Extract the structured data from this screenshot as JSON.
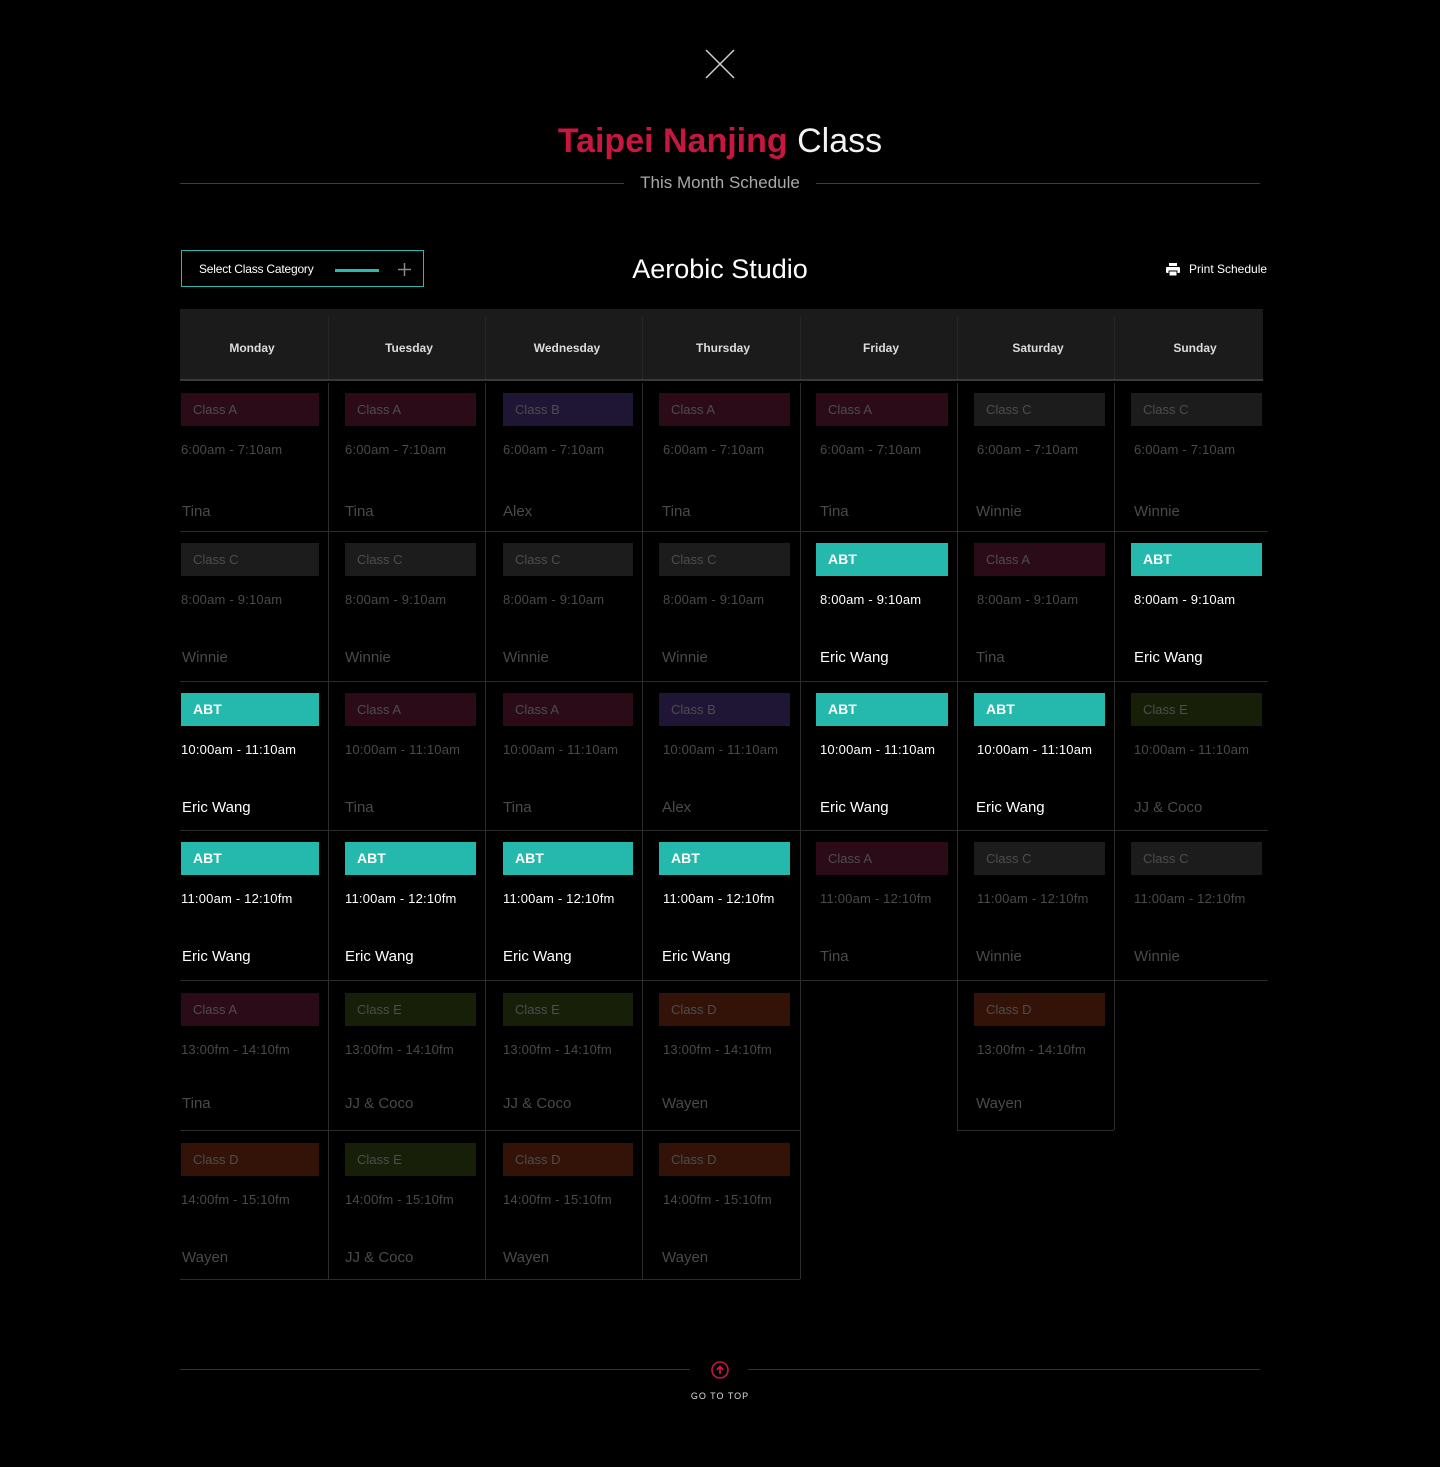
{
  "page": {
    "title_highlight": "Taipei Nanjing",
    "title_rest": "Class",
    "subtitle": "This Month Schedule",
    "studio": "Aerobic Studio",
    "select_label": "Select Class Category",
    "print_label": "Print Schedule",
    "go_to_top": "GO TO TOP"
  },
  "colors": {
    "accent": "#c8173e",
    "teal": "#25b9ad",
    "class_a": "#2b0b17",
    "class_b": "#1f1535",
    "class_c": "#1c1c1c",
    "class_d": "#331307",
    "class_e": "#171f08"
  },
  "days": [
    "Monday",
    "Tuesday",
    "Wednesday",
    "Thursday",
    "Friday",
    "Saturday",
    "Sunday"
  ],
  "schedule": [
    [
      {
        "cls": "Class A",
        "time": "6:00am - 7:10am",
        "teacher": "Tina",
        "type": "A"
      },
      {
        "cls": "Class C",
        "time": "8:00am - 9:10am",
        "teacher": "Winnie",
        "type": "C"
      },
      {
        "cls": "ABT",
        "time": "10:00am - 11:10am",
        "teacher": "Eric Wang",
        "type": "ABT"
      },
      {
        "cls": "ABT",
        "time": "11:00am - 12:10fm",
        "teacher": "Eric Wang",
        "type": "ABT"
      },
      {
        "cls": "Class A",
        "time": "13:00fm - 14:10fm",
        "teacher": "Tina",
        "type": "A"
      },
      {
        "cls": "Class D",
        "time": "14:00fm - 15:10fm",
        "teacher": "Wayen",
        "type": "D"
      }
    ],
    [
      {
        "cls": "Class A",
        "time": "6:00am - 7:10am",
        "teacher": "Tina",
        "type": "A"
      },
      {
        "cls": "Class C",
        "time": "8:00am - 9:10am",
        "teacher": "Winnie",
        "type": "C"
      },
      {
        "cls": "Class A",
        "time": "10:00am - 11:10am",
        "teacher": "Tina",
        "type": "A"
      },
      {
        "cls": "ABT",
        "time": "11:00am - 12:10fm",
        "teacher": "Eric Wang",
        "type": "ABT"
      },
      {
        "cls": "Class E",
        "time": "13:00fm - 14:10fm",
        "teacher": "JJ & Coco",
        "type": "E"
      },
      {
        "cls": "Class E",
        "time": "14:00fm - 15:10fm",
        "teacher": "JJ & Coco",
        "type": "E"
      }
    ],
    [
      {
        "cls": "Class B",
        "time": "6:00am - 7:10am",
        "teacher": "Alex",
        "type": "B"
      },
      {
        "cls": "Class C",
        "time": "8:00am - 9:10am",
        "teacher": "Winnie",
        "type": "C"
      },
      {
        "cls": "Class A",
        "time": "10:00am - 11:10am",
        "teacher": "Tina",
        "type": "A"
      },
      {
        "cls": "ABT",
        "time": "11:00am - 12:10fm",
        "teacher": "Eric Wang",
        "type": "ABT"
      },
      {
        "cls": "Class E",
        "time": "13:00fm - 14:10fm",
        "teacher": "JJ & Coco",
        "type": "E"
      },
      {
        "cls": "Class D",
        "time": "14:00fm - 15:10fm",
        "teacher": "Wayen",
        "type": "D"
      }
    ],
    [
      {
        "cls": "Class A",
        "time": "6:00am - 7:10am",
        "teacher": "Tina",
        "type": "A"
      },
      {
        "cls": "Class C",
        "time": "8:00am - 9:10am",
        "teacher": "Winnie",
        "type": "C"
      },
      {
        "cls": "Class B",
        "time": "10:00am - 11:10am",
        "teacher": "Alex",
        "type": "B"
      },
      {
        "cls": "ABT",
        "time": "11:00am - 12:10fm",
        "teacher": "Eric Wang",
        "type": "ABT"
      },
      {
        "cls": "Class D",
        "time": "13:00fm - 14:10fm",
        "teacher": "Wayen",
        "type": "D"
      },
      {
        "cls": "Class D",
        "time": "14:00fm - 15:10fm",
        "teacher": "Wayen",
        "type": "D"
      }
    ],
    [
      {
        "cls": "Class A",
        "time": "6:00am - 7:10am",
        "teacher": "Tina",
        "type": "A"
      },
      {
        "cls": "ABT",
        "time": "8:00am - 9:10am",
        "teacher": "Eric Wang",
        "type": "ABT"
      },
      {
        "cls": "ABT",
        "time": "10:00am - 11:10am",
        "teacher": "Eric Wang",
        "type": "ABT"
      },
      {
        "cls": "Class A",
        "time": "11:00am - 12:10fm",
        "teacher": "Tina",
        "type": "A"
      }
    ],
    [
      {
        "cls": "Class C",
        "time": "6:00am - 7:10am",
        "teacher": "Winnie",
        "type": "C"
      },
      {
        "cls": "Class A",
        "time": "8:00am - 9:10am",
        "teacher": "Tina",
        "type": "A"
      },
      {
        "cls": "ABT",
        "time": "10:00am - 11:10am",
        "teacher": "Eric Wang",
        "type": "ABT"
      },
      {
        "cls": "Class C",
        "time": "11:00am - 12:10fm",
        "teacher": "Winnie",
        "type": "C"
      },
      {
        "cls": "Class D",
        "time": "13:00fm - 14:10fm",
        "teacher": "Wayen",
        "type": "D"
      }
    ],
    [
      {
        "cls": "Class C",
        "time": "6:00am - 7:10am",
        "teacher": "Winnie",
        "type": "C"
      },
      {
        "cls": "ABT",
        "time": "8:00am - 9:10am",
        "teacher": "Eric Wang",
        "type": "ABT"
      },
      {
        "cls": "Class E",
        "time": "10:00am - 11:10am",
        "teacher": "JJ & Coco",
        "type": "E"
      },
      {
        "cls": "Class C",
        "time": "11:00am - 12:10fm",
        "teacher": "Winnie",
        "type": "C"
      }
    ]
  ]
}
